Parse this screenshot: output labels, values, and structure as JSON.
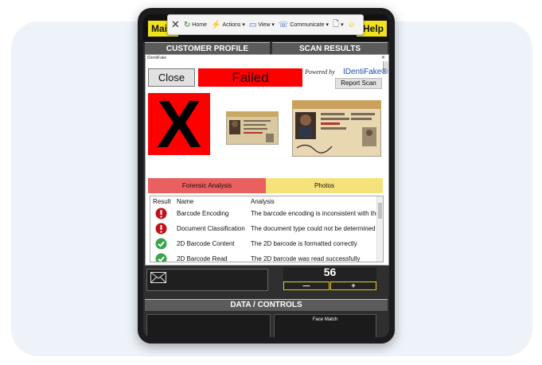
{
  "app": {
    "main_button": "Main",
    "help_button": "Help",
    "customer_profile_header": "CUSTOMER PROFILE",
    "scan_results_header": "SCAN RESULTS",
    "data_controls_header": "DATA / CONTROLS",
    "face_match_label": "Face Match",
    "count_value": "56",
    "minus_label": "—",
    "plus_label": "+"
  },
  "toolbar": {
    "home": "Home",
    "actions": "Actions",
    "view": "View",
    "communicate": "Communicate"
  },
  "popup": {
    "window_title": "IDentiFake",
    "close_button": "Close",
    "status": "Failed",
    "powered_by": "Powered by",
    "brand": "IDentiFake®",
    "report_button": "Report Scan",
    "tabs": [
      "Forensic Analysis",
      "Photos"
    ],
    "columns": [
      "Result",
      "Name",
      "Analysis"
    ],
    "rows": [
      {
        "result": "fail",
        "name": "Barcode Encoding",
        "analysis": "The barcode encoding is inconsistent with the d"
      },
      {
        "result": "fail",
        "name": "Document Classification",
        "analysis": "The document type could not be determined"
      },
      {
        "result": "pass",
        "name": "2D Barcode Content",
        "analysis": "The 2D barcode is formatted correctly"
      },
      {
        "result": "pass",
        "name": "2D Barcode Read",
        "analysis": "The 2D barcode was read successfully"
      }
    ]
  },
  "colors": {
    "fail": "#c0121a",
    "pass": "#3aa447",
    "failed_banner": "#ff0000",
    "forensic_tab": "#ea5f5f",
    "photos_tab": "#f6e27b",
    "accent_yellow": "#f2e21d"
  }
}
